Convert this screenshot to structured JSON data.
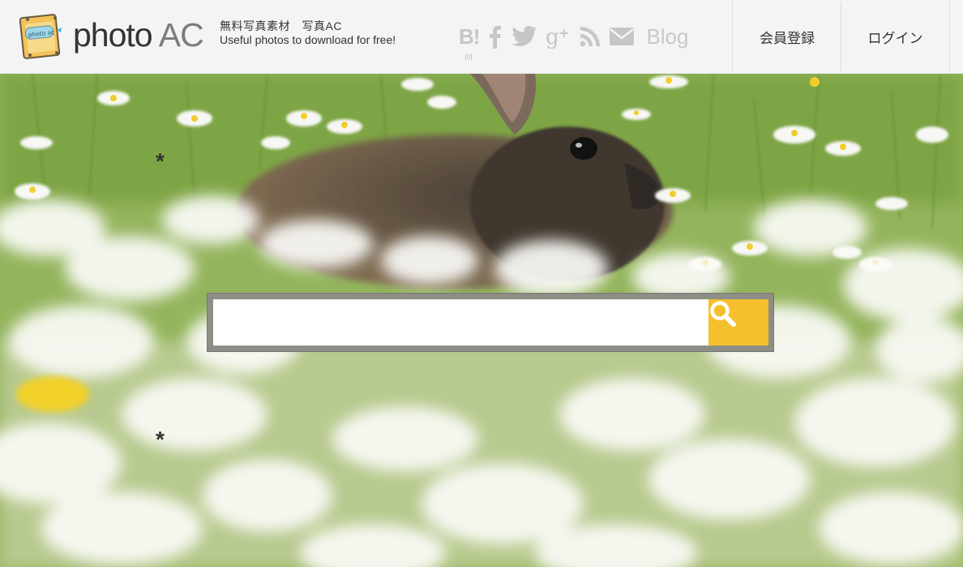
{
  "header": {
    "logo": {
      "badge_text": "photo ac",
      "word_photo": "photo",
      "word_ac": "AC"
    },
    "tagline": {
      "line1": "無料写真素材　写真AC",
      "line2": "Useful photos to download for free!"
    },
    "social": {
      "hatena_label": "B!",
      "hatena_count": "[0]",
      "icons": [
        "hatena-bookmark-icon",
        "facebook-icon",
        "twitter-icon",
        "google-plus-icon",
        "rss-icon",
        "mail-icon"
      ],
      "blog_label": "Blog"
    },
    "nav": {
      "register": "会員登録",
      "login": "ログイン"
    }
  },
  "hero": {
    "decoration_asterisk": "*",
    "search": {
      "value": "",
      "placeholder": "",
      "button_icon": "search-icon"
    }
  },
  "colors": {
    "header_bg": "#f4f4f4",
    "search_button": "#f5c02b",
    "logo_badge": "#f3c25a",
    "social_icon": "#c6c6c6"
  }
}
